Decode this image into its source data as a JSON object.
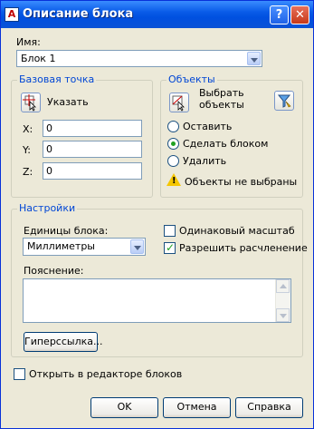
{
  "window": {
    "title": "Описание блока",
    "help_button": "?",
    "close_button": "✕"
  },
  "name_field": {
    "label": "Имя:",
    "value": "Блок 1"
  },
  "base_point": {
    "group_title": "Базовая точка",
    "pick_label": "Указать",
    "x_label": "X:",
    "x_value": "0",
    "y_label": "Y:",
    "y_value": "0",
    "z_label": "Z:",
    "z_value": "0"
  },
  "objects": {
    "group_title": "Объекты",
    "select_label_line1": "Выбрать",
    "select_label_line2": "объекты",
    "options": [
      "Оставить",
      "Сделать блоком",
      "Удалить"
    ],
    "selected_option": "Сделать блоком",
    "warning": "Объекты не выбраны"
  },
  "settings": {
    "group_title": "Настройки",
    "units_label": "Единицы блока:",
    "units_value": "Миллиметры",
    "uniform_scale": {
      "label": "Одинаковый масштаб",
      "checked": false
    },
    "allow_explode": {
      "label": "Разрешить расчленение",
      "checked": true
    },
    "description_label": "Пояснение:",
    "description_value": "",
    "hyperlink_button": "Гиперссылка..."
  },
  "open_in_editor": {
    "label": "Открыть в редакторе блоков",
    "checked": false
  },
  "buttons": {
    "ok": "OK",
    "cancel": "Отмена",
    "help": "Справка"
  },
  "colors": {
    "title_bar": "#0a5ce8",
    "group_title": "#0046d5",
    "face": "#ece9d8"
  }
}
